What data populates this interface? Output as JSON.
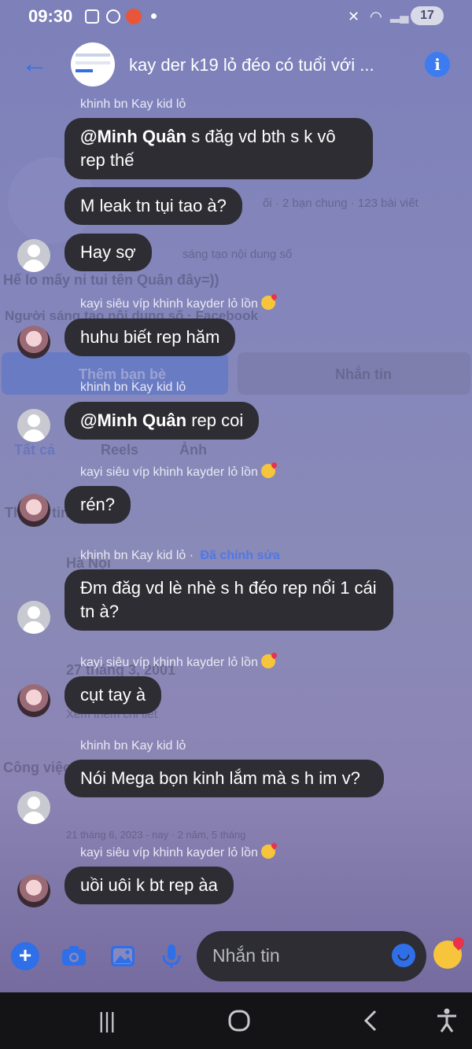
{
  "status_bar": {
    "time": "09:30",
    "battery": "17"
  },
  "header": {
    "title": "kay der k19 lỏ đéo có tuổi với ...",
    "back_icon": "arrow-left-icon",
    "info_icon": "info-icon"
  },
  "background_profile": {
    "stats": "ối · 2 bạn chung · 123 bài viết",
    "creator_line": "sáng tạo nội dung số",
    "bio": "Hế lo mấy ni tui tên Quân đây=))",
    "category": "Người sáng tạo nội dung số · Facebook",
    "add_friend": "Thêm bạn bè",
    "message": "Nhắn tin",
    "tab_all": "Tất cả",
    "tab_reels": "Reels",
    "tab_photos": "Ảnh",
    "details": "Thông tin cá nhân",
    "city": "Hà Nội",
    "birthday": "27 tháng 3, 2001",
    "see_more": "Xem thêm chi tiết",
    "work": "Công việc",
    "work_dates": "21 tháng 6, 2023 - nay · 2 năm, 5 tháng"
  },
  "messages": [
    {
      "sender": "khinh bn Kay kid lỏ",
      "mention": "@Minh Quân",
      "text": " s đăg vd bth s k vô rep thế"
    },
    {
      "text": "M leak tn tụi tao à?"
    },
    {
      "text": "Hay sợ"
    },
    {
      "sender": "kayi siêu víp khinh kayder lỏ lồn",
      "text": "huhu biết rep hăm"
    },
    {
      "sender": "khinh bn Kay kid lỏ",
      "mention": "@Minh Quân",
      "text": " rep coi"
    },
    {
      "sender": "kayi siêu víp khinh kayder lỏ lồn",
      "text": "rén?"
    },
    {
      "sender": "khinh bn Kay kid lỏ · ",
      "edited": "Đã chỉnh sửa",
      "text": "Đm đăg vd lè nhè s h đéo rep nổi 1 cái tn à?"
    },
    {
      "sender": "kayi siêu víp khinh kayder lỏ lồn",
      "text": "cụt tay à"
    },
    {
      "sender": "khinh bn Kay kid lỏ",
      "text": "Nói Mega bọn kinh lắm mà s h im v?"
    },
    {
      "sender": "kayi siêu víp khinh kayder lỏ lồn",
      "text": "uồi uôi k bt rep àa"
    }
  ],
  "composer": {
    "placeholder": "Nhắn tin",
    "icons": [
      "plus-icon",
      "camera-icon",
      "image-icon",
      "microphone-icon",
      "emoji-icon",
      "reaction-emoji-icon"
    ]
  },
  "navbar": {
    "icons": [
      "recent-apps-icon",
      "home-icon",
      "back-icon",
      "accessibility-icon"
    ]
  }
}
